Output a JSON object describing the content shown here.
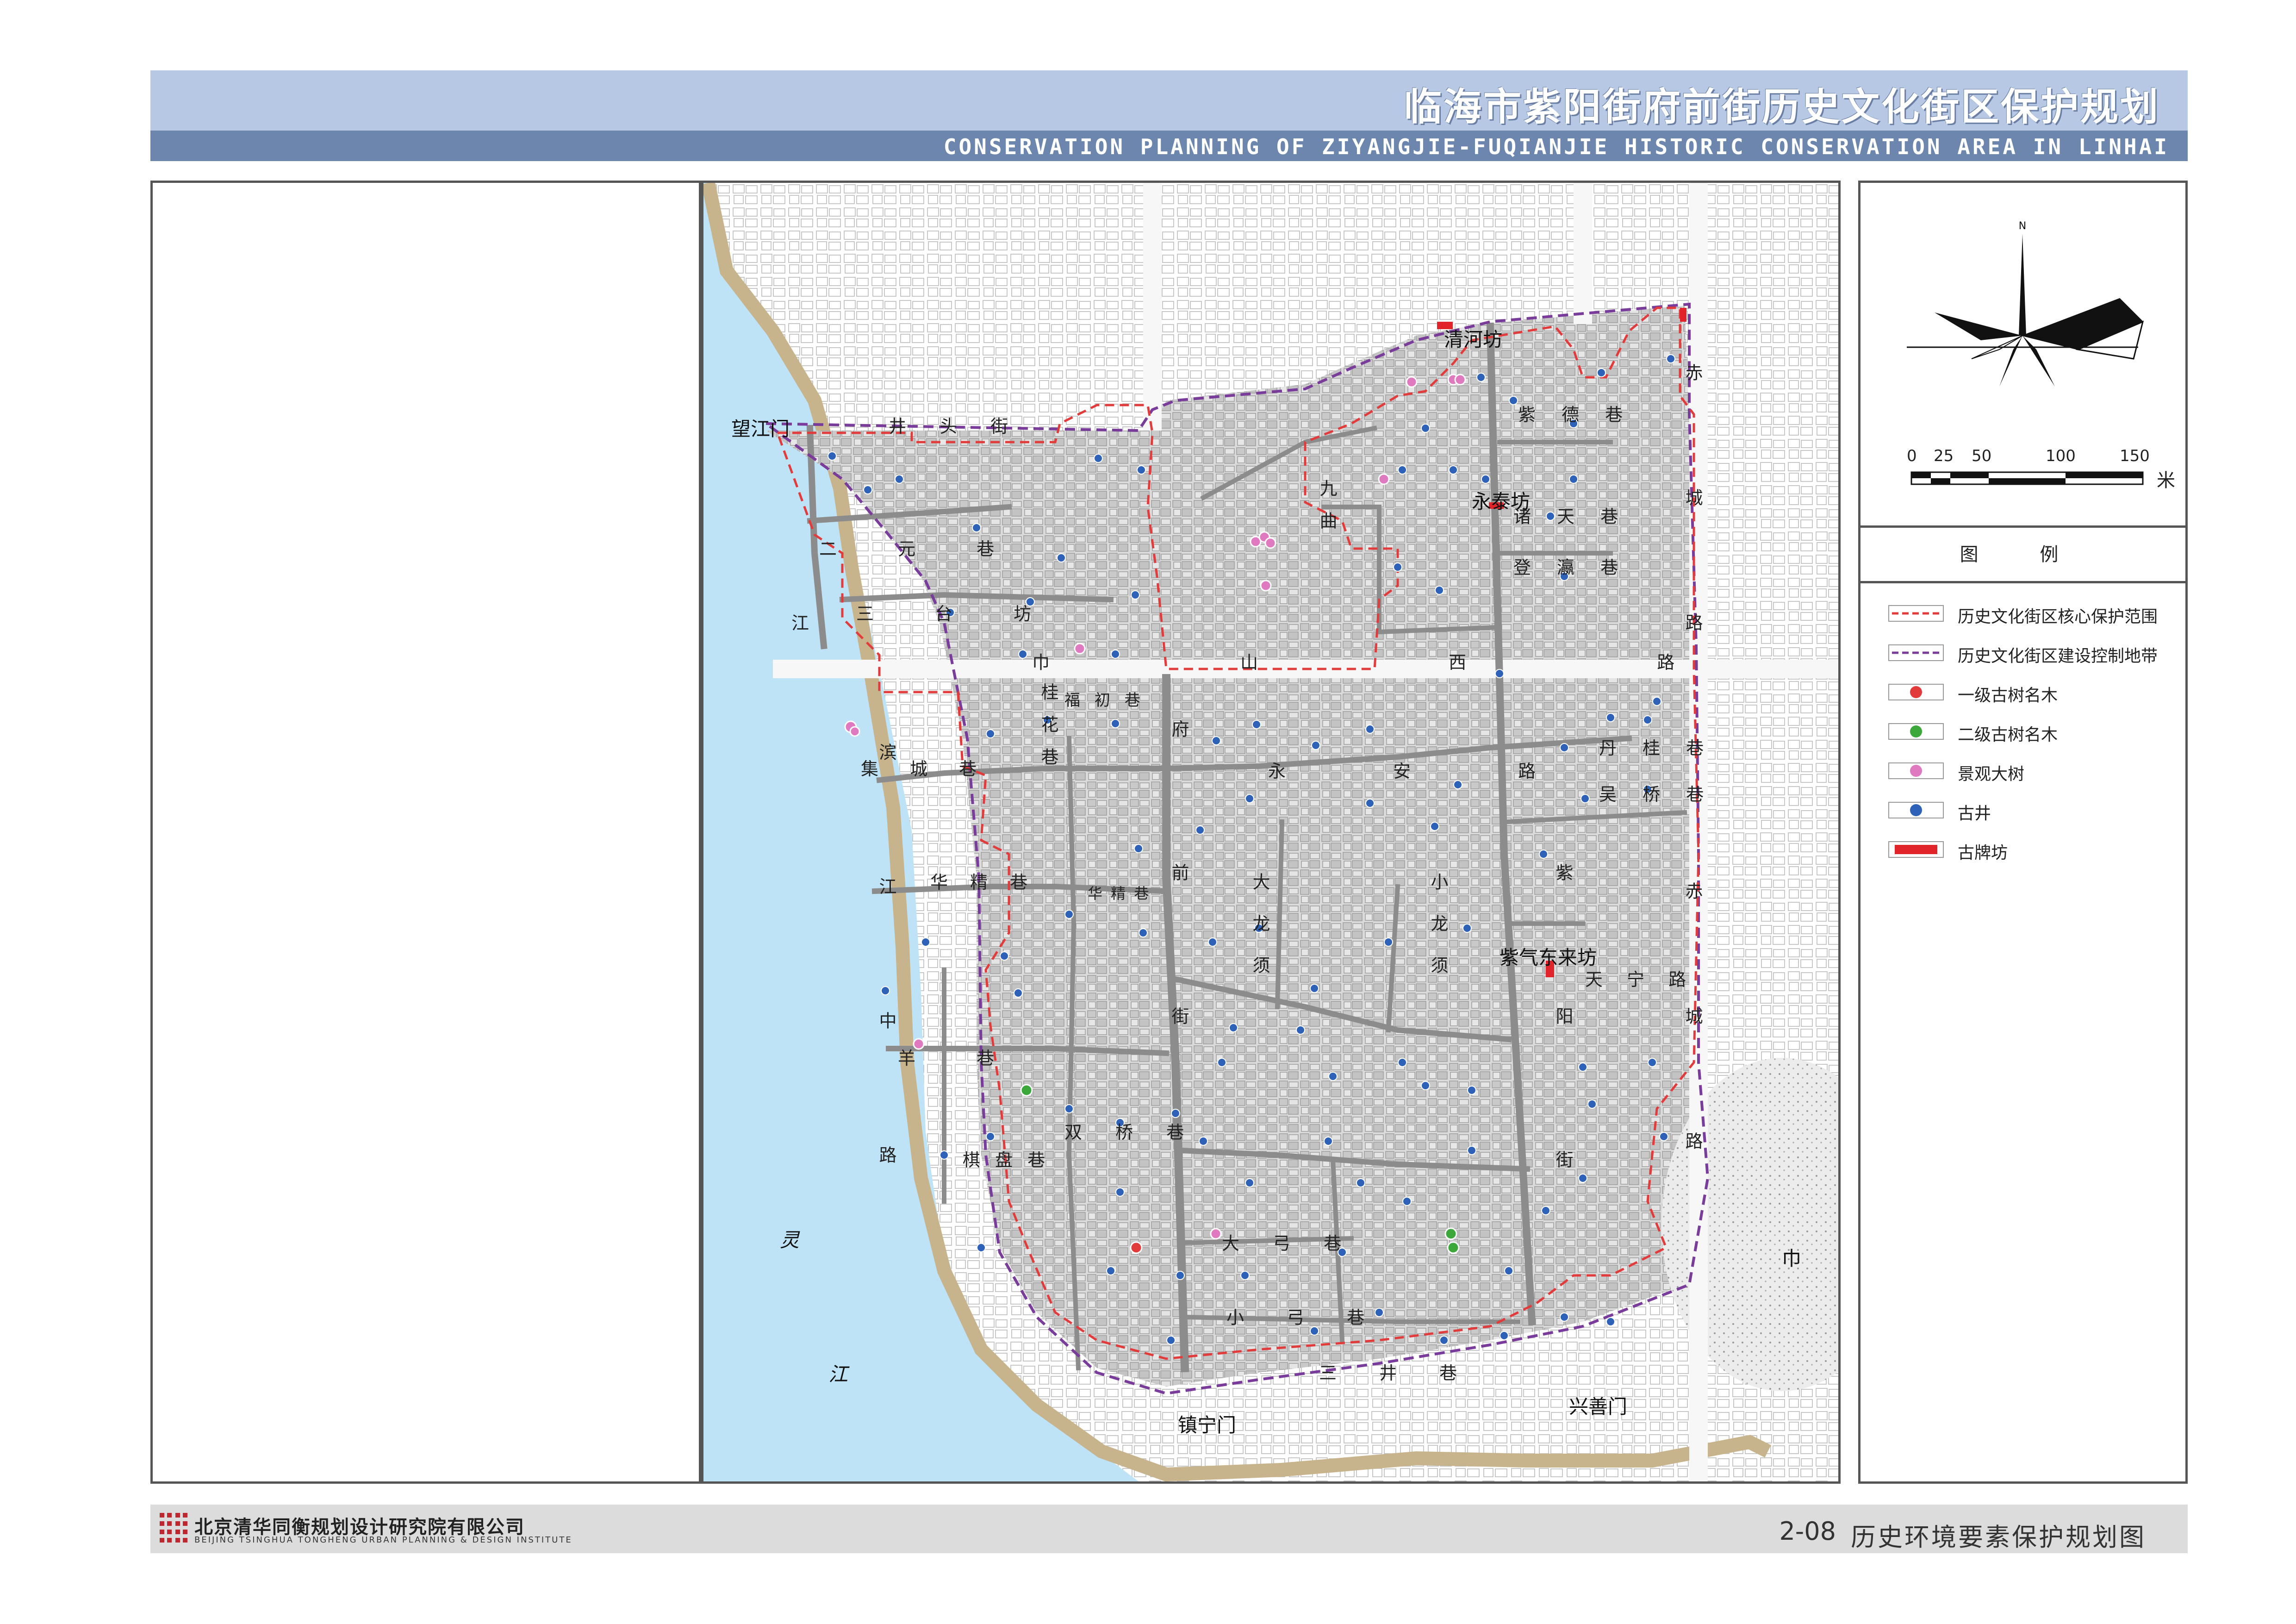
{
  "header": {
    "title_cn": "临海市紫阳街府前街历史文化街区保护规划",
    "title_en": "CONSERVATION PLANNING OF ZIYANGJIE-FUQIANJIE HISTORIC CONSERVATION AREA IN LINHAI"
  },
  "footer": {
    "company_cn": "北京清华同衡规划设计研究院有限公司",
    "company_en": "BEIJING TSINGHUA TONGHENG URBAN PLANNING & DESIGN INSTITUTE",
    "sheet_number": "2-08",
    "sheet_title": "历史环境要素保护规划图"
  },
  "compass": {
    "north": "N"
  },
  "scale_bar": {
    "labels": [
      "0",
      "25",
      "50",
      "100",
      "150"
    ],
    "unit": "米"
  },
  "legend": {
    "title": "图   例",
    "items": [
      {
        "label": "历史文化街区核心保护范围",
        "color": "#e23b3b",
        "symbol": "dashed-line"
      },
      {
        "label": "历史文化街区建设控制地带",
        "color": "#7a3c9a",
        "symbol": "dashed-line"
      },
      {
        "label": "一级古树名木",
        "color": "#e23b3b",
        "symbol": "circle"
      },
      {
        "label": "二级古树名木",
        "color": "#3ca83c",
        "symbol": "circle"
      },
      {
        "label": "景观大树",
        "color": "#e07ac0",
        "symbol": "circle"
      },
      {
        "label": "古井",
        "color": "#2e62b8",
        "symbol": "circle"
      },
      {
        "label": "古牌坊",
        "color": "#e0242a",
        "symbol": "rect"
      }
    ]
  },
  "map": {
    "place_labels": {
      "wangjiangmen": "望江门",
      "qinghefang": "清河坊",
      "yongtaifang": "永泰坊",
      "ziqidonglaifang": "紫气东来坊",
      "zhenningmen": "镇宁门",
      "xingshanmen": "兴善门",
      "jinshan": "巾 山",
      "ling": "灵",
      "jiang": "江",
      "jiang_left": "江"
    },
    "street_labels": {
      "jingtoujie": "井 头 街",
      "eryuanxiang": "二 元 巷",
      "santaifang": "三 台 坊",
      "jinshanxilu": "巾 山 西 路",
      "jichengxiang": "集 城 巷",
      "huajingxiang_w": "华 精 巷",
      "huajingxiang_e": "华 精 巷",
      "guihuaxiang": "桂 花 巷",
      "fuchuxiang": "福 初 巷",
      "fuqianjie": "府 前 街",
      "yonganlu": "永 安 路",
      "dalongxu": "大 龙 须",
      "xiaolongxu": "小 龙 须",
      "ziyangjie": "紫 阳 街",
      "tianninglu": "天 宁 路",
      "chichenglu_n": "赤 城 路",
      "chichenglu_s": "赤 城 路",
      "danshuxiang": "丹 桂 巷",
      "lanjiaxiang": "吴 桥 巷",
      "binjiangzhonglu": "滨 江 中 路",
      "yanxiang": "羊 巷",
      "shuangqiaoxiang": "双 桥 巷",
      "qipanxiang": "棋 盘 巷",
      "dagongxiang": "大 弓 巷",
      "xiaogongxiang": "小 弓 巷",
      "sanjixiang": "三 井 巷",
      "dengyingxiang": "登 瀛 巷",
      "zhutianxiang": "诸 天 巷",
      "ziyangxiang": "紫 德 巷",
      "jiuxing": "九 曲",
      "qingshanhu": "清 河 坊"
    }
  }
}
